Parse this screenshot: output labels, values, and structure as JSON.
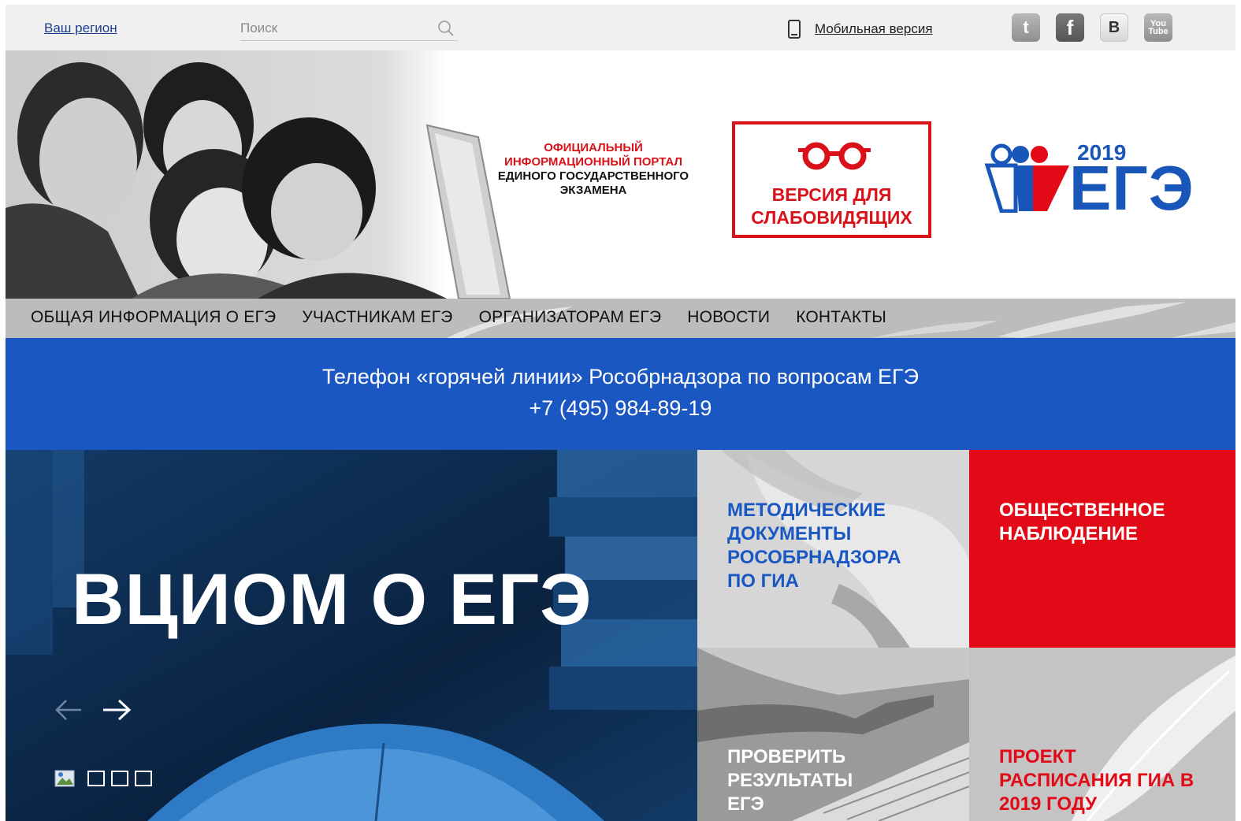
{
  "topbar": {
    "region_link": "Ваш регион",
    "search_placeholder": "Поиск",
    "mobile_link": "Мобильная версия",
    "social": [
      {
        "name": "twitter",
        "glyph": "t"
      },
      {
        "name": "facebook",
        "glyph": "f"
      },
      {
        "name": "vkontakte",
        "glyph": "B"
      },
      {
        "name": "youtube",
        "glyph": "You Tube"
      }
    ]
  },
  "header": {
    "portal_red_lines": [
      "ОФИЦИАЛЬНЫЙ",
      "ИНФОРМАЦИОННЫЙ ПОРТАЛ"
    ],
    "portal_black_lines": [
      "ЕДИНОГО ГОСУДАРСТВЕННОГО",
      "ЭКЗАМЕНА"
    ],
    "low_vision_line1": "ВЕРСИЯ ДЛЯ",
    "low_vision_line2": "СЛАБОВИДЯЩИХ",
    "logo_year": "2019",
    "logo_word": "ЕГЭ"
  },
  "nav": {
    "items": [
      "ОБЩАЯ ИНФОРМАЦИЯ О ЕГЭ",
      "УЧАСТНИКАМ ЕГЭ",
      "ОРГАНИЗАТОРАМ ЕГЭ",
      "НОВОСТИ",
      "КОНТАКТЫ"
    ]
  },
  "hotline": {
    "title": "Телефон «горячей линии» Рособрнадзора по вопросам ЕГЭ",
    "phone": "+7 (495) 984-89-19"
  },
  "hero": {
    "title": "ВЦИОМ О ЕГЭ",
    "slides_count": 4,
    "active_slide": 1
  },
  "tiles": [
    {
      "lines": [
        "МЕТОДИЧЕСКИЕ",
        "ДОКУМЕНТЫ",
        "РОСОБРНАДЗОРА",
        "ПО ГИА"
      ]
    },
    {
      "lines": [
        "ОБЩЕСТВЕННОЕ",
        "НАБЛЮДЕНИЕ"
      ]
    },
    {
      "lines": [
        "ПРОВЕРИТЬ",
        "РЕЗУЛЬТАТЫ",
        "ЕГЭ"
      ]
    },
    {
      "lines": [
        "ПРОЕКТ",
        "РАСПИСАНИЯ ГИА В",
        "2019 ГОДУ"
      ]
    }
  ],
  "colors": {
    "brand_blue": "#1a57c2",
    "brand_red": "#e20a16",
    "nav_gray": "#bcbcbc"
  }
}
